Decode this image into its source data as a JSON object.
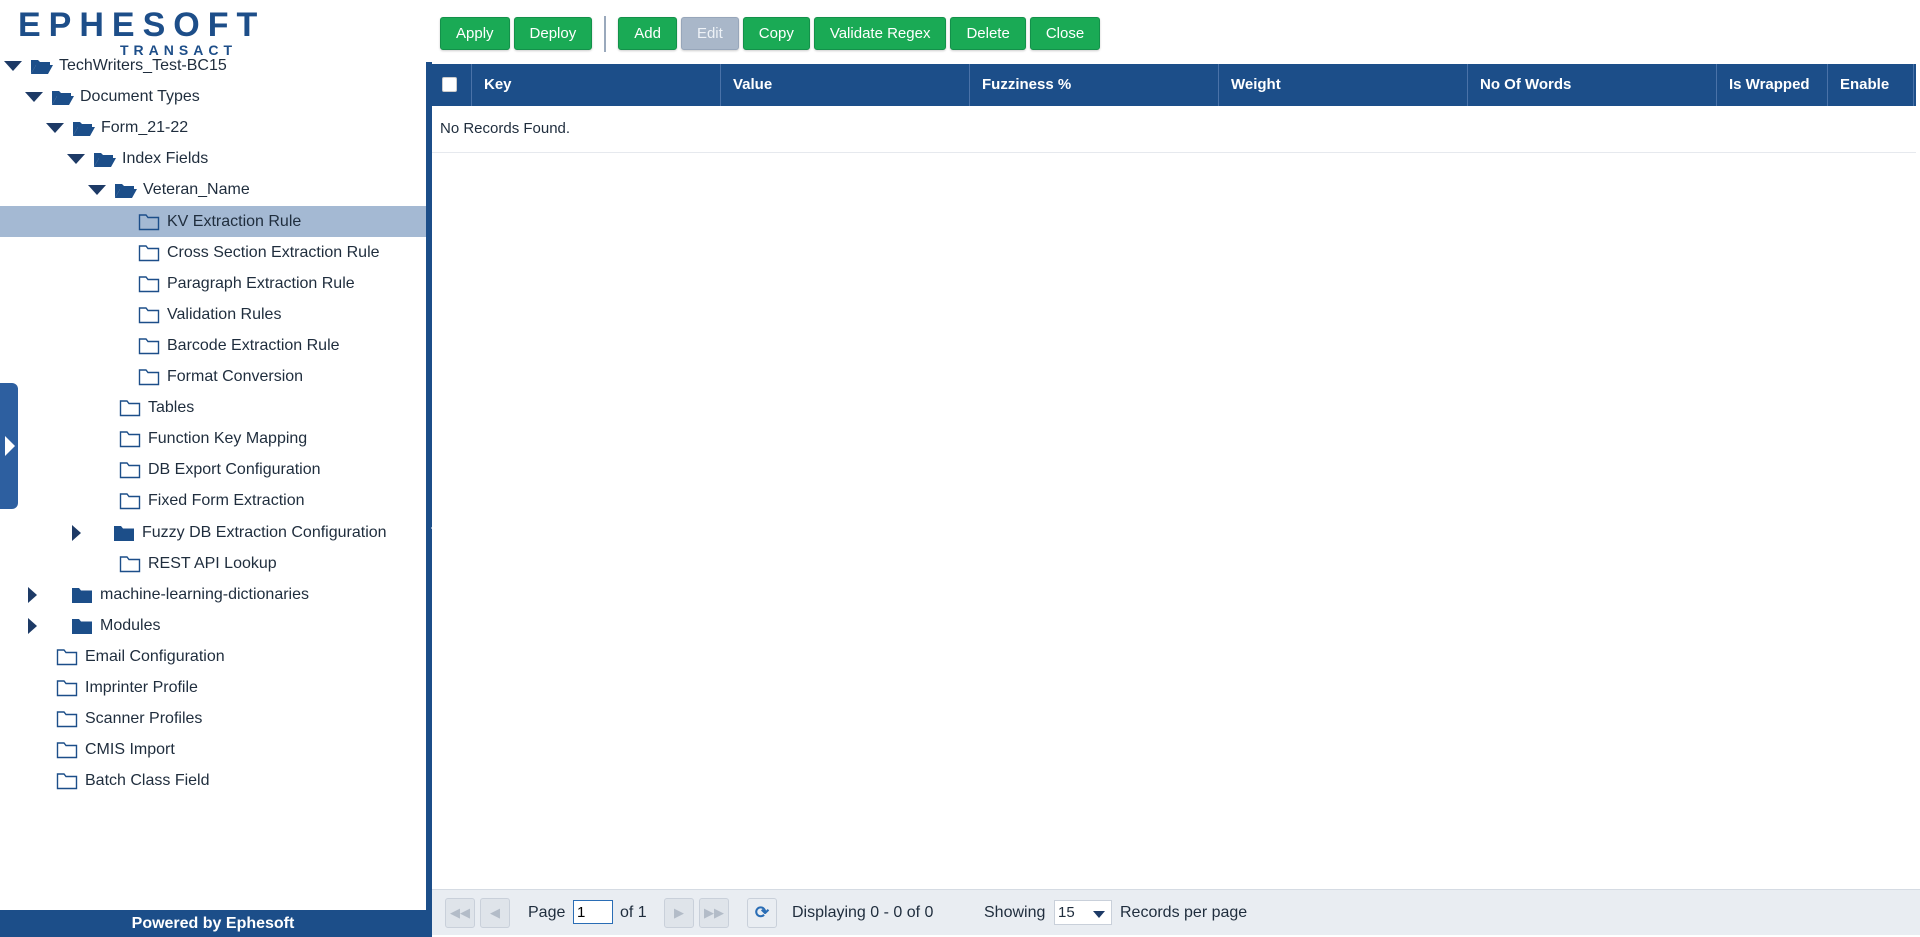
{
  "logo": {
    "brand": "EPHESOFT",
    "sub": "TRANSACT"
  },
  "toolbar": {
    "buttons": [
      {
        "label": "Apply"
      },
      {
        "label": "Deploy"
      },
      {
        "label": "Add"
      },
      {
        "label": "Edit",
        "disabled": true
      },
      {
        "label": "Copy"
      },
      {
        "label": "Validate Regex"
      },
      {
        "label": "Delete"
      },
      {
        "label": "Close"
      }
    ]
  },
  "tree": [
    {
      "label": "TechWriters_Test-BC15",
      "expander": "down",
      "folder": "open"
    },
    {
      "label": "Document Types",
      "expander": "down",
      "folder": "open"
    },
    {
      "label": "Form_21-22",
      "expander": "down",
      "folder": "open"
    },
    {
      "label": "Index Fields",
      "expander": "down",
      "folder": "open"
    },
    {
      "label": "Veteran_Name",
      "expander": "down",
      "folder": "open"
    },
    {
      "label": "KV Extraction Rule",
      "folder": "outline",
      "selected": true
    },
    {
      "label": "Cross Section Extraction Rule",
      "folder": "outline"
    },
    {
      "label": "Paragraph Extraction Rule",
      "folder": "outline"
    },
    {
      "label": "Validation Rules",
      "folder": "outline"
    },
    {
      "label": "Barcode Extraction Rule",
      "folder": "outline"
    },
    {
      "label": "Format Conversion",
      "folder": "outline"
    },
    {
      "label": "Tables",
      "folder": "outline"
    },
    {
      "label": "Function Key Mapping",
      "folder": "outline"
    },
    {
      "label": "DB Export Configuration",
      "folder": "outline"
    },
    {
      "label": "Fixed Form Extraction",
      "folder": "outline"
    },
    {
      "label": "Fuzzy DB Extraction Configuration",
      "expander": "right",
      "folder": "closed"
    },
    {
      "label": "REST API Lookup",
      "folder": "outline"
    },
    {
      "label": "machine-learning-dictionaries",
      "expander": "right",
      "folder": "closed"
    },
    {
      "label": "Modules",
      "expander": "right",
      "folder": "closed"
    },
    {
      "label": "Email Configuration",
      "folder": "outline"
    },
    {
      "label": "Imprinter Profile",
      "folder": "outline"
    },
    {
      "label": "Scanner Profiles",
      "folder": "outline"
    },
    {
      "label": "CMIS Import",
      "folder": "outline"
    },
    {
      "label": "Batch Class Field",
      "folder": "outline"
    }
  ],
  "grid": {
    "columns": [
      "Key",
      "Value",
      "Fuzziness %",
      "Weight",
      "No Of Words",
      "Is Wrapped",
      "Enable"
    ],
    "empty_text": "No Records Found."
  },
  "pager": {
    "page_label": "Page",
    "page_value": "1",
    "of_label": "of 1",
    "displaying": "Displaying 0 - 0 of 0",
    "showing_label": "Showing",
    "page_size": "15",
    "per_page_label": "Records per page"
  },
  "footer": {
    "powered_by": "Powered by Ephesoft"
  },
  "colors": {
    "accent": "#1c4e89",
    "button": "#1aaa55",
    "selected": "#a4b9d3"
  }
}
